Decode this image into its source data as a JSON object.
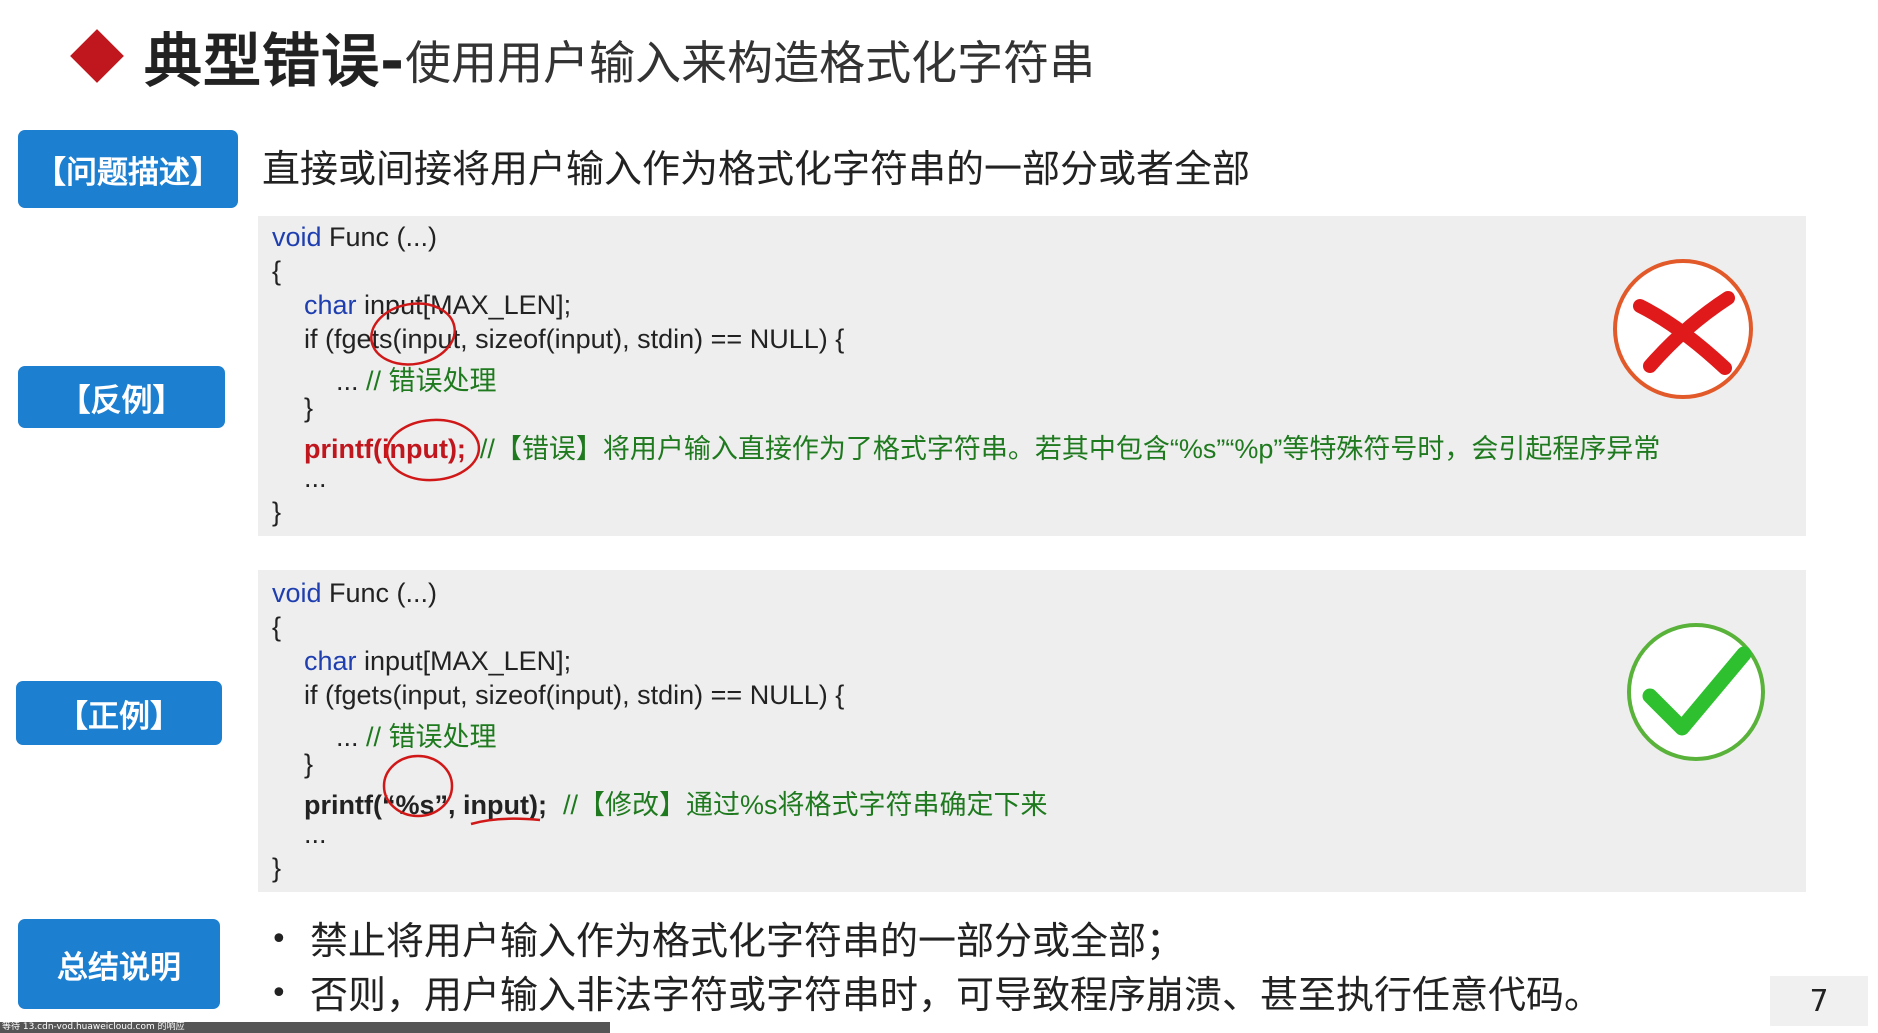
{
  "title": {
    "main": "典型错误-",
    "sub": "使用用户输入来构造格式化字符串"
  },
  "labels": {
    "problem": "【问题描述】",
    "bad": "【反例】",
    "good": "【正例】",
    "summary": "总结说明"
  },
  "description": "直接或间接将用户输入作为格式化字符串的一部分或者全部",
  "bad_code": {
    "l1_kw": "void",
    "l1_rest": " Func (...)",
    "l2": "{",
    "l3_kw": "char",
    "l3_rest": " input[MAX_LEN];",
    "l4": "if (fgets(input, sizeof(input), stdin) == NULL) {",
    "l5_pre": "... ",
    "l5_cm": "// 错误处理",
    "l6": "}",
    "l7_code": "printf(input);",
    "l7_cm": "//【错误】将用户输入直接作为了格式字符串。若其中包含“%s”“%p”等特殊符号时，会引起程序异常",
    "l8": "...",
    "l9": "}"
  },
  "good_code": {
    "l1_kw": "void",
    "l1_rest": " Func (...)",
    "l2": "{",
    "l3_kw": "char",
    "l3_rest": " input[MAX_LEN];",
    "l4": "if (fgets(input, sizeof(input), stdin) == NULL) {",
    "l5_pre": "... ",
    "l5_cm": "// 错误处理",
    "l6": "}",
    "l7_code": "printf(“%s”, input);",
    "l7_cm": "//【修改】通过%s将格式字符串确定下来",
    "l8": "...",
    "l9": "}"
  },
  "summary": {
    "bullet": "•",
    "line1": "禁止将用户输入作为格式化字符串的一部分或全部；",
    "line2": "否则，用户输入非法字符或字符串时，可导致程序崩溃、甚至执行任意代码。"
  },
  "page_number": "7",
  "status_text": "等待 13.cdn-vod.huaweicloud.com 的响应",
  "colors": {
    "accent": "#1c7fd0",
    "error": "#c0161d",
    "ok": "#3aa82a",
    "comment": "#1f7a1f",
    "keyword": "#1f3fb0"
  }
}
